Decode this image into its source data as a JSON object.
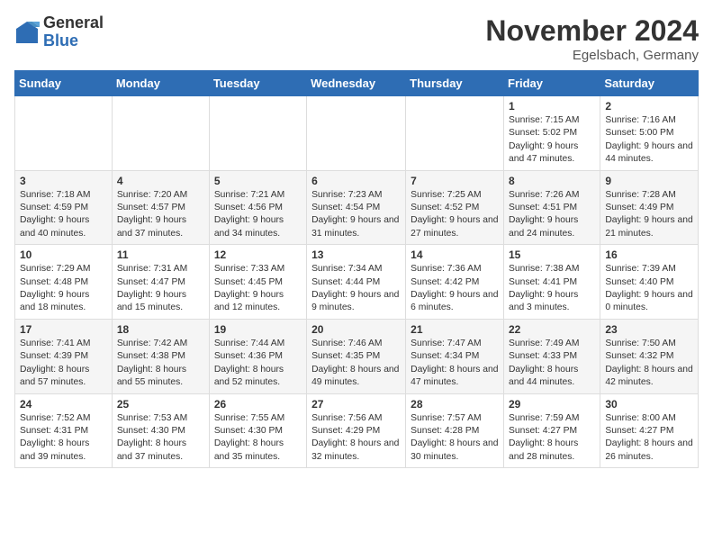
{
  "logo": {
    "general": "General",
    "blue": "Blue"
  },
  "title": "November 2024",
  "location": "Egelsbach, Germany",
  "weekdays": [
    "Sunday",
    "Monday",
    "Tuesday",
    "Wednesday",
    "Thursday",
    "Friday",
    "Saturday"
  ],
  "weeks": [
    [
      {
        "day": "",
        "info": ""
      },
      {
        "day": "",
        "info": ""
      },
      {
        "day": "",
        "info": ""
      },
      {
        "day": "",
        "info": ""
      },
      {
        "day": "",
        "info": ""
      },
      {
        "day": "1",
        "info": "Sunrise: 7:15 AM\nSunset: 5:02 PM\nDaylight: 9 hours and 47 minutes."
      },
      {
        "day": "2",
        "info": "Sunrise: 7:16 AM\nSunset: 5:00 PM\nDaylight: 9 hours and 44 minutes."
      }
    ],
    [
      {
        "day": "3",
        "info": "Sunrise: 7:18 AM\nSunset: 4:59 PM\nDaylight: 9 hours and 40 minutes."
      },
      {
        "day": "4",
        "info": "Sunrise: 7:20 AM\nSunset: 4:57 PM\nDaylight: 9 hours and 37 minutes."
      },
      {
        "day": "5",
        "info": "Sunrise: 7:21 AM\nSunset: 4:56 PM\nDaylight: 9 hours and 34 minutes."
      },
      {
        "day": "6",
        "info": "Sunrise: 7:23 AM\nSunset: 4:54 PM\nDaylight: 9 hours and 31 minutes."
      },
      {
        "day": "7",
        "info": "Sunrise: 7:25 AM\nSunset: 4:52 PM\nDaylight: 9 hours and 27 minutes."
      },
      {
        "day": "8",
        "info": "Sunrise: 7:26 AM\nSunset: 4:51 PM\nDaylight: 9 hours and 24 minutes."
      },
      {
        "day": "9",
        "info": "Sunrise: 7:28 AM\nSunset: 4:49 PM\nDaylight: 9 hours and 21 minutes."
      }
    ],
    [
      {
        "day": "10",
        "info": "Sunrise: 7:29 AM\nSunset: 4:48 PM\nDaylight: 9 hours and 18 minutes."
      },
      {
        "day": "11",
        "info": "Sunrise: 7:31 AM\nSunset: 4:47 PM\nDaylight: 9 hours and 15 minutes."
      },
      {
        "day": "12",
        "info": "Sunrise: 7:33 AM\nSunset: 4:45 PM\nDaylight: 9 hours and 12 minutes."
      },
      {
        "day": "13",
        "info": "Sunrise: 7:34 AM\nSunset: 4:44 PM\nDaylight: 9 hours and 9 minutes."
      },
      {
        "day": "14",
        "info": "Sunrise: 7:36 AM\nSunset: 4:42 PM\nDaylight: 9 hours and 6 minutes."
      },
      {
        "day": "15",
        "info": "Sunrise: 7:38 AM\nSunset: 4:41 PM\nDaylight: 9 hours and 3 minutes."
      },
      {
        "day": "16",
        "info": "Sunrise: 7:39 AM\nSunset: 4:40 PM\nDaylight: 9 hours and 0 minutes."
      }
    ],
    [
      {
        "day": "17",
        "info": "Sunrise: 7:41 AM\nSunset: 4:39 PM\nDaylight: 8 hours and 57 minutes."
      },
      {
        "day": "18",
        "info": "Sunrise: 7:42 AM\nSunset: 4:38 PM\nDaylight: 8 hours and 55 minutes."
      },
      {
        "day": "19",
        "info": "Sunrise: 7:44 AM\nSunset: 4:36 PM\nDaylight: 8 hours and 52 minutes."
      },
      {
        "day": "20",
        "info": "Sunrise: 7:46 AM\nSunset: 4:35 PM\nDaylight: 8 hours and 49 minutes."
      },
      {
        "day": "21",
        "info": "Sunrise: 7:47 AM\nSunset: 4:34 PM\nDaylight: 8 hours and 47 minutes."
      },
      {
        "day": "22",
        "info": "Sunrise: 7:49 AM\nSunset: 4:33 PM\nDaylight: 8 hours and 44 minutes."
      },
      {
        "day": "23",
        "info": "Sunrise: 7:50 AM\nSunset: 4:32 PM\nDaylight: 8 hours and 42 minutes."
      }
    ],
    [
      {
        "day": "24",
        "info": "Sunrise: 7:52 AM\nSunset: 4:31 PM\nDaylight: 8 hours and 39 minutes."
      },
      {
        "day": "25",
        "info": "Sunrise: 7:53 AM\nSunset: 4:30 PM\nDaylight: 8 hours and 37 minutes."
      },
      {
        "day": "26",
        "info": "Sunrise: 7:55 AM\nSunset: 4:30 PM\nDaylight: 8 hours and 35 minutes."
      },
      {
        "day": "27",
        "info": "Sunrise: 7:56 AM\nSunset: 4:29 PM\nDaylight: 8 hours and 32 minutes."
      },
      {
        "day": "28",
        "info": "Sunrise: 7:57 AM\nSunset: 4:28 PM\nDaylight: 8 hours and 30 minutes."
      },
      {
        "day": "29",
        "info": "Sunrise: 7:59 AM\nSunset: 4:27 PM\nDaylight: 8 hours and 28 minutes."
      },
      {
        "day": "30",
        "info": "Sunrise: 8:00 AM\nSunset: 4:27 PM\nDaylight: 8 hours and 26 minutes."
      }
    ]
  ]
}
